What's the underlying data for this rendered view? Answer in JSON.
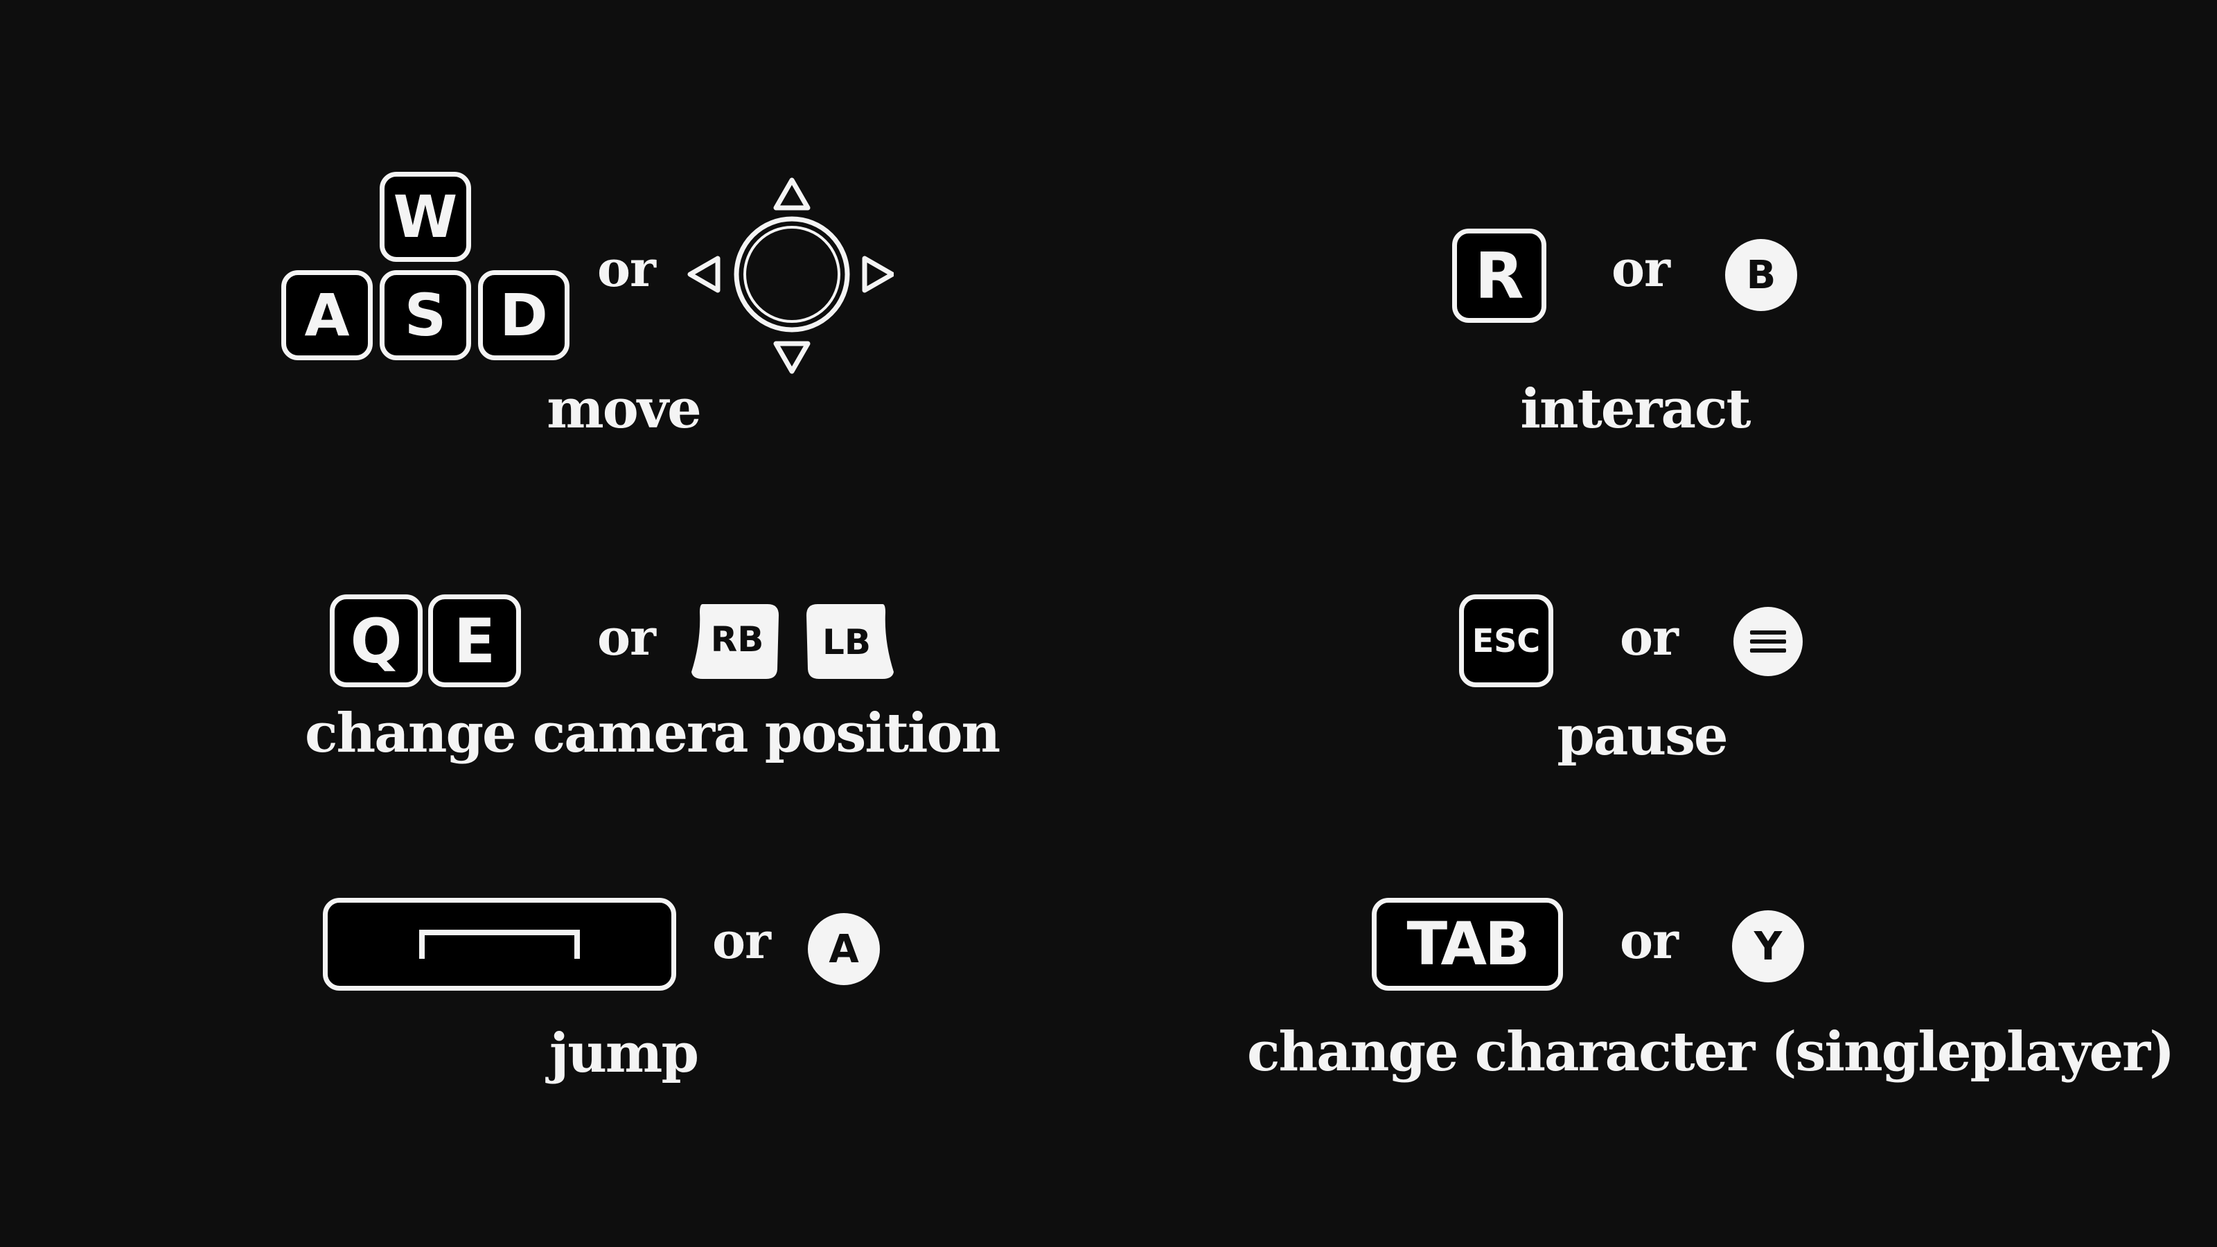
{
  "bindings": [
    {
      "action": "move",
      "keyboard": [
        "W",
        "A",
        "S",
        "D"
      ],
      "connector": "or",
      "controller_icon": "left-stick-icon"
    },
    {
      "action": "interact",
      "keyboard": [
        "R"
      ],
      "connector": "or",
      "controller_button": "B"
    },
    {
      "action": "change camera position",
      "keyboard": [
        "Q",
        "E"
      ],
      "connector": "or",
      "controller_buttons": [
        "RB",
        "LB"
      ]
    },
    {
      "action": "pause",
      "keyboard": [
        "ESC"
      ],
      "connector": "or",
      "controller_icon": "menu-icon"
    },
    {
      "action": "jump",
      "keyboard_icon": "spacebar-icon",
      "connector": "or",
      "controller_button": "A"
    },
    {
      "action": "change character (singleplayer)",
      "keyboard": [
        "TAB"
      ],
      "connector": "or",
      "controller_button": "Y"
    }
  ],
  "colors": {
    "background": "#0e0e0e",
    "foreground": "#f4f4f4",
    "key_fill": "#000000"
  }
}
